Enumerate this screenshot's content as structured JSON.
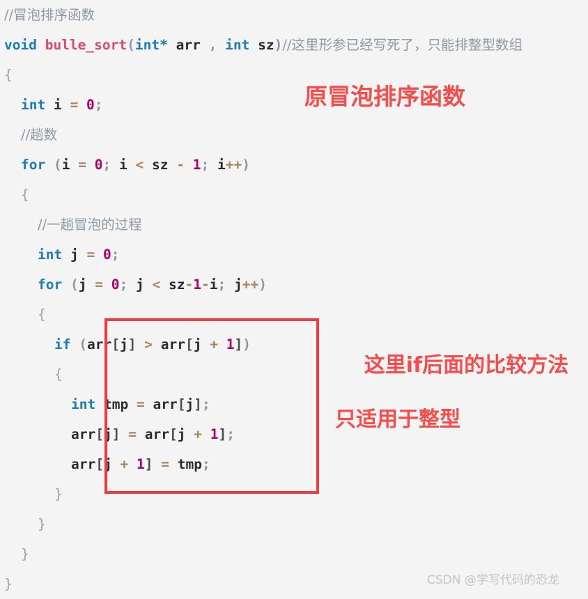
{
  "page": {
    "background_color": "#f4f4f4",
    "language": "c"
  },
  "colors": {
    "keyword": "#1a7cb8",
    "function_name": "#e0496d",
    "number": "#b2006b",
    "operator": "#a9845c",
    "comment": "#8e99a6",
    "punctuation": "#8a96a3",
    "identifier": "#2b2b2b",
    "annotation_red": "#fa4b4b",
    "box_border_red": "#f4393c",
    "watermark_gray": "#c4c4c4"
  },
  "code": {
    "lines": [
      {
        "indent": 0,
        "tokens": [
          {
            "t": "//冒泡排序函数",
            "c": "cmt"
          }
        ]
      },
      {
        "indent": 0,
        "tokens": [
          {
            "t": "void",
            "c": "kw"
          },
          {
            "t": " ",
            "c": "id"
          },
          {
            "t": "bulle_sort",
            "c": "fn"
          },
          {
            "t": "(",
            "c": "pun"
          },
          {
            "t": "int",
            "c": "kw"
          },
          {
            "t": "*",
            "c": "kw"
          },
          {
            "t": " ",
            "c": "id"
          },
          {
            "t": "arr",
            "c": "id"
          },
          {
            "t": " ",
            "c": "id"
          },
          {
            "t": ",",
            "c": "pun"
          },
          {
            "t": " ",
            "c": "id"
          },
          {
            "t": "int",
            "c": "kw"
          },
          {
            "t": " ",
            "c": "id"
          },
          {
            "t": "sz",
            "c": "id"
          },
          {
            "t": ")",
            "c": "pun"
          },
          {
            "t": "//这里形参已经写死了，只能排整型数组",
            "c": "cmt"
          }
        ]
      },
      {
        "indent": 0,
        "tokens": [
          {
            "t": "{",
            "c": "brace"
          }
        ]
      },
      {
        "indent": 1,
        "tokens": [
          {
            "t": "int",
            "c": "kw"
          },
          {
            "t": " ",
            "c": "id"
          },
          {
            "t": "i",
            "c": "id"
          },
          {
            "t": " ",
            "c": "id"
          },
          {
            "t": "=",
            "c": "op"
          },
          {
            "t": " ",
            "c": "id"
          },
          {
            "t": "0",
            "c": "num"
          },
          {
            "t": ";",
            "c": "pun"
          }
        ]
      },
      {
        "indent": 1,
        "tokens": [
          {
            "t": "//趟数",
            "c": "cmt"
          }
        ]
      },
      {
        "indent": 1,
        "tokens": [
          {
            "t": "for",
            "c": "kw"
          },
          {
            "t": " ",
            "c": "id"
          },
          {
            "t": "(",
            "c": "pun"
          },
          {
            "t": "i",
            "c": "id"
          },
          {
            "t": " ",
            "c": "id"
          },
          {
            "t": "=",
            "c": "op"
          },
          {
            "t": " ",
            "c": "id"
          },
          {
            "t": "0",
            "c": "num"
          },
          {
            "t": ";",
            "c": "pun"
          },
          {
            "t": " ",
            "c": "id"
          },
          {
            "t": "i",
            "c": "id"
          },
          {
            "t": " ",
            "c": "id"
          },
          {
            "t": "<",
            "c": "op"
          },
          {
            "t": " ",
            "c": "id"
          },
          {
            "t": "sz",
            "c": "id"
          },
          {
            "t": " ",
            "c": "id"
          },
          {
            "t": "-",
            "c": "op"
          },
          {
            "t": " ",
            "c": "id"
          },
          {
            "t": "1",
            "c": "num"
          },
          {
            "t": ";",
            "c": "pun"
          },
          {
            "t": " ",
            "c": "id"
          },
          {
            "t": "i",
            "c": "id"
          },
          {
            "t": "++",
            "c": "op"
          },
          {
            "t": ")",
            "c": "pun"
          }
        ]
      },
      {
        "indent": 1,
        "tokens": [
          {
            "t": "{",
            "c": "brace"
          }
        ]
      },
      {
        "indent": 2,
        "tokens": [
          {
            "t": "//一趟冒泡的过程",
            "c": "cmt"
          }
        ]
      },
      {
        "indent": 2,
        "tokens": [
          {
            "t": "int",
            "c": "kw"
          },
          {
            "t": " ",
            "c": "id"
          },
          {
            "t": "j",
            "c": "id"
          },
          {
            "t": " ",
            "c": "id"
          },
          {
            "t": "=",
            "c": "op"
          },
          {
            "t": " ",
            "c": "id"
          },
          {
            "t": "0",
            "c": "num"
          },
          {
            "t": ";",
            "c": "pun"
          }
        ]
      },
      {
        "indent": 2,
        "tokens": [
          {
            "t": "for",
            "c": "kw"
          },
          {
            "t": " ",
            "c": "id"
          },
          {
            "t": "(",
            "c": "pun"
          },
          {
            "t": "j",
            "c": "id"
          },
          {
            "t": " ",
            "c": "id"
          },
          {
            "t": "=",
            "c": "op"
          },
          {
            "t": " ",
            "c": "id"
          },
          {
            "t": "0",
            "c": "num"
          },
          {
            "t": ";",
            "c": "pun"
          },
          {
            "t": " ",
            "c": "id"
          },
          {
            "t": "j",
            "c": "id"
          },
          {
            "t": " ",
            "c": "id"
          },
          {
            "t": "<",
            "c": "op"
          },
          {
            "t": " ",
            "c": "id"
          },
          {
            "t": "sz",
            "c": "id"
          },
          {
            "t": "-",
            "c": "op"
          },
          {
            "t": "1",
            "c": "num"
          },
          {
            "t": "-",
            "c": "op"
          },
          {
            "t": "i",
            "c": "id"
          },
          {
            "t": ";",
            "c": "pun"
          },
          {
            "t": " ",
            "c": "id"
          },
          {
            "t": "j",
            "c": "id"
          },
          {
            "t": "++",
            "c": "op"
          },
          {
            "t": ")",
            "c": "pun"
          }
        ]
      },
      {
        "indent": 2,
        "tokens": [
          {
            "t": "{",
            "c": "brace"
          }
        ]
      },
      {
        "indent": 3,
        "tokens": [
          {
            "t": "if",
            "c": "kw"
          },
          {
            "t": " ",
            "c": "id"
          },
          {
            "t": "(",
            "c": "pun"
          },
          {
            "t": "arr",
            "c": "id"
          },
          {
            "t": "[",
            "c": "brk"
          },
          {
            "t": "j",
            "c": "id"
          },
          {
            "t": "]",
            "c": "brk"
          },
          {
            "t": " ",
            "c": "id"
          },
          {
            "t": ">",
            "c": "op"
          },
          {
            "t": " ",
            "c": "id"
          },
          {
            "t": "arr",
            "c": "id"
          },
          {
            "t": "[",
            "c": "brk"
          },
          {
            "t": "j",
            "c": "id"
          },
          {
            "t": " ",
            "c": "id"
          },
          {
            "t": "+",
            "c": "op"
          },
          {
            "t": " ",
            "c": "id"
          },
          {
            "t": "1",
            "c": "num"
          },
          {
            "t": "]",
            "c": "brk"
          },
          {
            "t": ")",
            "c": "pun"
          }
        ]
      },
      {
        "indent": 3,
        "tokens": [
          {
            "t": "{",
            "c": "brace"
          }
        ]
      },
      {
        "indent": 4,
        "tokens": [
          {
            "t": "int",
            "c": "kw"
          },
          {
            "t": " ",
            "c": "id"
          },
          {
            "t": "tmp",
            "c": "id"
          },
          {
            "t": " ",
            "c": "id"
          },
          {
            "t": "=",
            "c": "op"
          },
          {
            "t": " ",
            "c": "id"
          },
          {
            "t": "arr",
            "c": "id"
          },
          {
            "t": "[",
            "c": "brk"
          },
          {
            "t": "j",
            "c": "id"
          },
          {
            "t": "]",
            "c": "brk"
          },
          {
            "t": ";",
            "c": "pun"
          }
        ]
      },
      {
        "indent": 4,
        "tokens": [
          {
            "t": "arr",
            "c": "id"
          },
          {
            "t": "[",
            "c": "brk"
          },
          {
            "t": "j",
            "c": "id"
          },
          {
            "t": "]",
            "c": "brk"
          },
          {
            "t": " ",
            "c": "id"
          },
          {
            "t": "=",
            "c": "op"
          },
          {
            "t": " ",
            "c": "id"
          },
          {
            "t": "arr",
            "c": "id"
          },
          {
            "t": "[",
            "c": "brk"
          },
          {
            "t": "j",
            "c": "id"
          },
          {
            "t": " ",
            "c": "id"
          },
          {
            "t": "+",
            "c": "op"
          },
          {
            "t": " ",
            "c": "id"
          },
          {
            "t": "1",
            "c": "num"
          },
          {
            "t": "]",
            "c": "brk"
          },
          {
            "t": ";",
            "c": "pun"
          }
        ]
      },
      {
        "indent": 4,
        "tokens": [
          {
            "t": "arr",
            "c": "id"
          },
          {
            "t": "[",
            "c": "brk"
          },
          {
            "t": "j",
            "c": "id"
          },
          {
            "t": " ",
            "c": "id"
          },
          {
            "t": "+",
            "c": "op"
          },
          {
            "t": " ",
            "c": "id"
          },
          {
            "t": "1",
            "c": "num"
          },
          {
            "t": "]",
            "c": "brk"
          },
          {
            "t": " ",
            "c": "id"
          },
          {
            "t": "=",
            "c": "op"
          },
          {
            "t": " ",
            "c": "id"
          },
          {
            "t": "tmp",
            "c": "id"
          },
          {
            "t": ";",
            "c": "pun"
          }
        ]
      },
      {
        "indent": 3,
        "tokens": [
          {
            "t": "}",
            "c": "brace"
          }
        ]
      },
      {
        "indent": 2,
        "tokens": [
          {
            "t": "}",
            "c": "brace"
          }
        ]
      },
      {
        "indent": 1,
        "tokens": [
          {
            "t": "}",
            "c": "brace"
          }
        ]
      },
      {
        "indent": 0,
        "tokens": [
          {
            "t": "}",
            "c": "brace"
          }
        ]
      }
    ]
  },
  "annotations": {
    "first": "原冒泡排序函数",
    "second_line1": "这里if后面的比较方法",
    "second_line2": "只适用于整型"
  },
  "watermark": {
    "text": "CSDN @学写代码的恐龙"
  }
}
